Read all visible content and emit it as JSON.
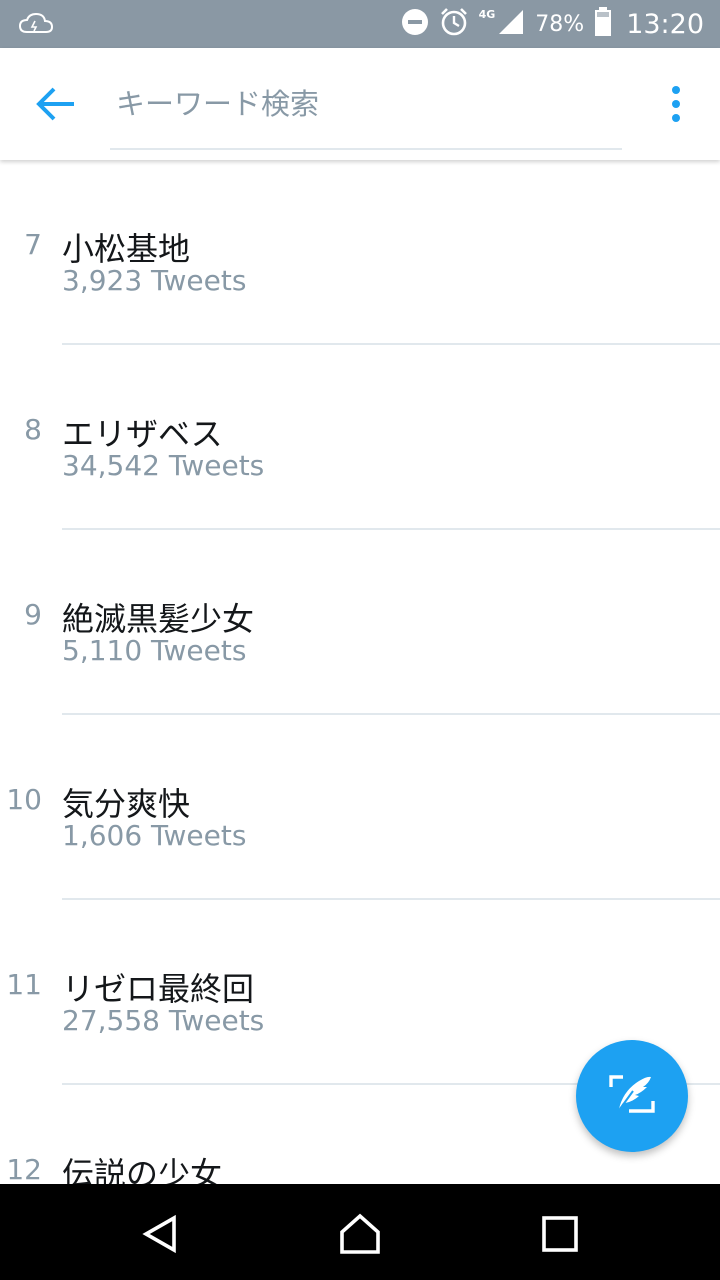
{
  "status_bar": {
    "network": "4G",
    "battery": "78%",
    "time": "13:20"
  },
  "search": {
    "placeholder": "キーワード検索"
  },
  "trends": [
    {
      "rank": "7",
      "name": "小松基地",
      "count": "3,923 Tweets"
    },
    {
      "rank": "8",
      "name": "エリザベス",
      "count": "34,542 Tweets"
    },
    {
      "rank": "9",
      "name": "絶滅黒髪少女",
      "count": "5,110 Tweets"
    },
    {
      "rank": "10",
      "name": "気分爽快",
      "count": "1,606 Tweets"
    },
    {
      "rank": "11",
      "name": "リゼロ最終回",
      "count": "27,558 Tweets"
    },
    {
      "rank": "12",
      "name": "伝説の少女",
      "count": ""
    }
  ],
  "colors": {
    "accent": "#1da1f2",
    "status_bar": "#8a98a4",
    "secondary_text": "#8899a6",
    "divider": "#e1e8ed"
  }
}
